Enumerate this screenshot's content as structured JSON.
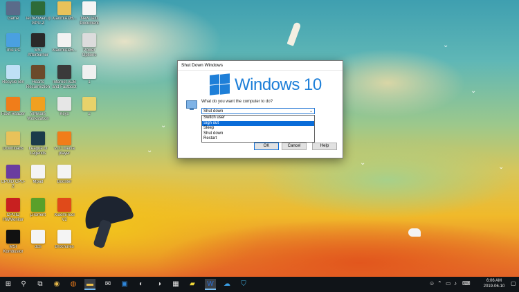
{
  "desktop": {
    "icons": [
      {
        "label": "Game",
        "icon": "game-icon",
        "color": "#5a6b8a"
      },
      {
        "label": "TechPowerUp GPU-Z",
        "icon": "gpu-z-icon",
        "color": "#2d6b38"
      },
      {
        "label": "XiaomiADB...",
        "icon": "folder-icon",
        "color": "#e9c25a"
      },
      {
        "label": "New Text Document",
        "icon": "text-document-icon",
        "color": "#f4f4f4"
      },
      {
        "label": "This PC",
        "icon": "this-pc-icon",
        "color": "#4aa0e0"
      },
      {
        "label": "MSI Afterburner",
        "icon": "msi-afterburner-icon",
        "color": "#2a2a2a"
      },
      {
        "label": "XiaomiADB...",
        "icon": "java-icon",
        "color": "#f2f2f2"
      },
      {
        "label": "Power Options",
        "icon": "power-options-icon",
        "color": "#dcdcdc"
      },
      {
        "label": "Recycle Bin",
        "icon": "recycle-bin-icon",
        "color": "#bfe0f5"
      },
      {
        "label": "Hearts Resurrection",
        "icon": "hearts-game-icon",
        "color": "#6b4a2a"
      },
      {
        "label": "Internet ADB and Fastboot",
        "icon": "adb-installer-icon",
        "color": "#3a3a3a"
      },
      {
        "label": "1",
        "icon": "file-icon",
        "color": "#f0f0f0"
      },
      {
        "label": "Foxit Reader",
        "icon": "foxit-reader-icon",
        "color": "#f07d1a"
      },
      {
        "label": "VMware Workstation",
        "icon": "vmware-icon",
        "color": "#f0a020"
      },
      {
        "label": "Keys",
        "icon": "keys-icon",
        "color": "#e6e6e6"
      },
      {
        "label": "2",
        "icon": "image-file-icon",
        "color": "#e8d26a"
      },
      {
        "label": "Downloads",
        "icon": "downloads-folder-icon",
        "color": "#e9c25a"
      },
      {
        "label": "League of Legends",
        "icon": "league-icon",
        "color": "#1b3b4a"
      },
      {
        "label": "VLC media player",
        "icon": "vlc-icon",
        "color": "#f07d1a"
      },
      {
        "label": "CPUID CPU-Z",
        "icon": "cpu-z-icon",
        "color": "#6a3da0"
      },
      {
        "label": "Mpad",
        "icon": "mpad-icon",
        "color": "#f4f4f4"
      },
      {
        "label": "Booster",
        "icon": "booster-icon",
        "color": "#f4f4f4"
      },
      {
        "label": "CPUID HWMonitor",
        "icon": "hwmonitor-icon",
        "color": "#c82020"
      },
      {
        "label": "µTorrent",
        "icon": "utorrent-icon",
        "color": "#5aa02a"
      },
      {
        "label": "XiaomiTool V2",
        "icon": "xiaomitool-icon",
        "color": "#e04a1a"
      },
      {
        "label": "MSI Kombustor",
        "icon": "kombustor-icon",
        "color": "#111111"
      },
      {
        "label": "dds",
        "icon": "document-icon",
        "color": "#f4f4f4"
      },
      {
        "label": "Brochures",
        "icon": "document-icon-2",
        "color": "#f4f4f4"
      }
    ]
  },
  "dialog": {
    "title": "Shut Down Windows",
    "brand": "Windows 10",
    "brand_color": "#1e7fd8",
    "question": "What do you want the computer to do?",
    "selected_value": "Shut down",
    "options": [
      "Switch user",
      "Sign out",
      "Sleep",
      "Shut down",
      "Restart"
    ],
    "highlighted_option": "Sign out",
    "ok_label": "OK",
    "cancel_label": "Cancel",
    "help_label": "Help"
  },
  "taskbar": {
    "clock_time": "6:06 AM",
    "clock_date": "2019-06-10",
    "apps": [
      {
        "icon": "start-icon"
      },
      {
        "icon": "search-icon"
      },
      {
        "icon": "task-view-icon"
      },
      {
        "icon": "chrome-icon"
      },
      {
        "icon": "firefox-icon"
      },
      {
        "icon": "file-explorer-icon"
      },
      {
        "icon": "mail-icon"
      },
      {
        "icon": "outlook-icon"
      },
      {
        "icon": "ccleaner-icon"
      },
      {
        "icon": "calculator-icon"
      },
      {
        "icon": "sticky-notes-icon"
      },
      {
        "icon": "word-icon"
      },
      {
        "icon": "skype-icon"
      },
      {
        "icon": "vpn-icon"
      }
    ]
  }
}
